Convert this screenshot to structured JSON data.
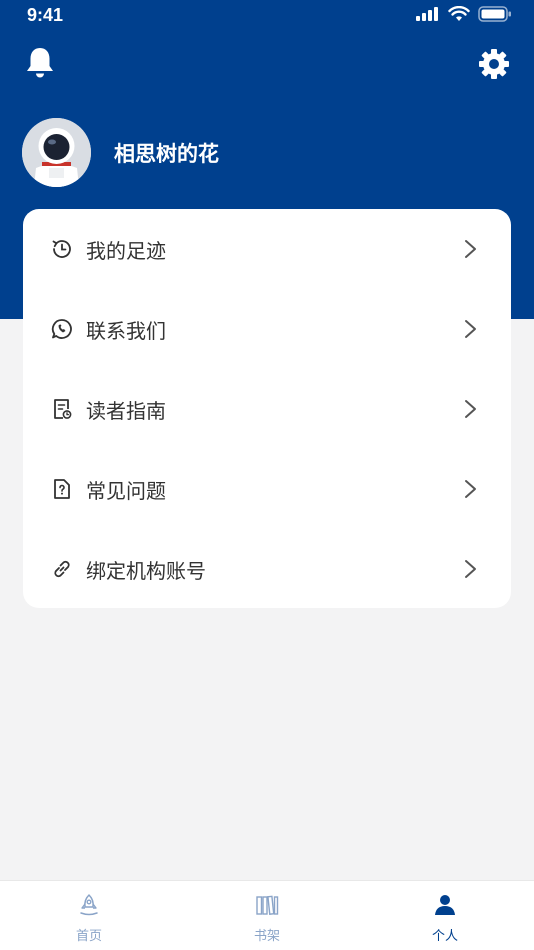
{
  "status_bar": {
    "time": "9:41"
  },
  "colors": {
    "brand": "#00408e",
    "background": "#f3f3f4",
    "tab_inactive": "#8aa4c8"
  },
  "header": {
    "bell_icon": "bell-icon",
    "settings_icon": "gear-icon"
  },
  "profile": {
    "name": "相思树的花",
    "avatar_icon": "astronaut-avatar"
  },
  "menu": {
    "items": [
      {
        "label": "我的足迹",
        "icon": "history-clock-icon"
      },
      {
        "label": "联系我们",
        "icon": "whatsapp-phone-icon"
      },
      {
        "label": "读者指南",
        "icon": "document-guide-icon"
      },
      {
        "label": "常见问题",
        "icon": "question-document-icon"
      },
      {
        "label": "绑定机构账号",
        "icon": "link-icon"
      }
    ]
  },
  "tabbar": {
    "tabs": [
      {
        "label": "首页",
        "icon": "rocket-icon",
        "active": false
      },
      {
        "label": "书架",
        "icon": "bookshelf-icon",
        "active": false
      },
      {
        "label": "个人",
        "icon": "person-icon",
        "active": true
      }
    ]
  }
}
